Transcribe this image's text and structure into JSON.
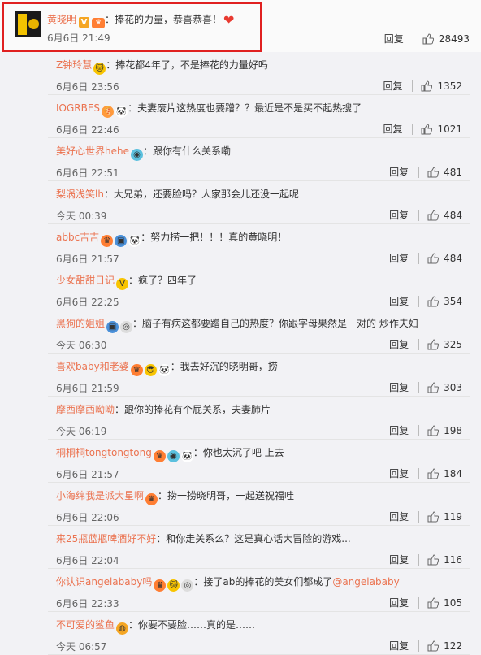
{
  "top": {
    "username": "黄晓明",
    "badge": "V",
    "separator": "：",
    "text": "捧花的力量，恭喜恭喜！",
    "time": "6月6日 21:49",
    "reply": "回复",
    "likes": "28493",
    "heart": "❤"
  },
  "replies": [
    {
      "username": "Z钟玲慧",
      "text": "：捧花都4年了，不是捧花的力量好吗",
      "time": "6月6日 23:56",
      "reply": "回复",
      "likes": "1352"
    },
    {
      "username": "IOGRBES",
      "text": "：夫妻废片这热度也要蹭？？最近是不是买不起热搜了",
      "time": "6月6日 22:46",
      "reply": "回复",
      "likes": "1021"
    },
    {
      "username": "美好心世界hehe",
      "text": "：跟你有什么关系嘞",
      "time": "6月6日 22:51",
      "reply": "回复",
      "likes": "481"
    },
    {
      "username": "梨涡浅笑lh",
      "text": "：大兄弟，还要脸吗？人家那会儿还没一起呢",
      "time": "今天 00:39",
      "reply": "回复",
      "likes": "484"
    },
    {
      "username": "abbc吉吉",
      "text": "：努力捞一把！！！真的黄晓明！",
      "time": "6月6日 21:57",
      "reply": "回复",
      "likes": "484"
    },
    {
      "username": "少女甜甜日记",
      "text": "：疯了？四年了",
      "time": "6月6日 22:25",
      "reply": "回复",
      "likes": "354"
    },
    {
      "username": "黑狗的姐姐",
      "text": "：脑子有病这都要蹭自己的热度？你跟字母果然是一对的 炒作夫妇",
      "time": "今天 06:30",
      "reply": "回复",
      "likes": "325"
    },
    {
      "username": "喜欢baby和老婆",
      "text": "：我去好沉的晓明哥，捞",
      "time": "6月6日 21:59",
      "reply": "回复",
      "likes": "303"
    },
    {
      "username": "摩西摩西呦呦",
      "text": "：跟你的捧花有个屁关系，夫妻肺片",
      "time": "今天 06:19",
      "reply": "回复",
      "likes": "198"
    },
    {
      "username": "桐桐桐tongtongtong",
      "text": "：你也太沉了吧 上去",
      "time": "6月6日 21:57",
      "reply": "回复",
      "likes": "184"
    },
    {
      "username": "小海绵我是派大星啊",
      "text": "：捞一捞晓明哥，一起送祝福哇",
      "time": "6月6日 22:06",
      "reply": "回复",
      "likes": "119"
    },
    {
      "username": "来25瓶蓝瓶啤酒好不好",
      "text": "：和你走关系么？这是真心话大冒险的游戏...",
      "time": "6月6日 22:04",
      "reply": "回复",
      "likes": "116"
    },
    {
      "username": "你认识angelababy吗",
      "text": "：接了ab的捧花的美女们都成了",
      "mention": "@angelababy",
      "time": "6月6日 22:33",
      "reply": "回复",
      "likes": "105"
    },
    {
      "username": "不可爱的鲨鱼",
      "text": "：你要不要脸……真的是……",
      "time": "今天 06:57",
      "reply": "回复",
      "likes": "122"
    }
  ],
  "colors": {
    "username": "#eb7350",
    "highlight": "#e02020",
    "background": "#f2f2f5"
  }
}
